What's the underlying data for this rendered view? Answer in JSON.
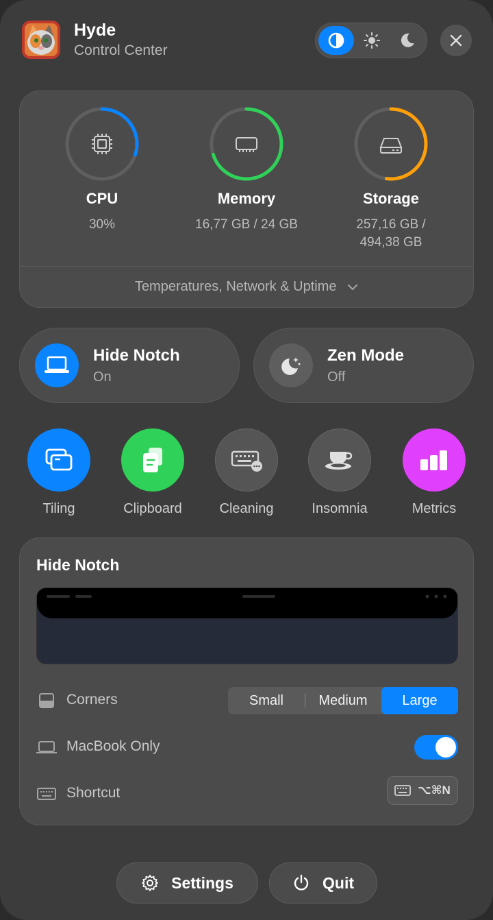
{
  "header": {
    "app_name": "Hyde",
    "subtitle": "Control Center",
    "theme_modes": [
      "auto",
      "light",
      "dark"
    ],
    "active_theme": "auto"
  },
  "stats": [
    {
      "label": "CPU",
      "value": "30%",
      "fraction": 0.3,
      "color": "#0a84ff",
      "icon": "cpu-icon"
    },
    {
      "label": "Memory",
      "value": "16,77 GB / 24 GB",
      "fraction": 0.7,
      "color": "#30d158",
      "icon": "memory-icon"
    },
    {
      "label": "Storage",
      "value_line1": "257,16 GB /",
      "value_line2": "494,38 GB",
      "fraction": 0.52,
      "color": "#ff9f0a",
      "icon": "drive-icon"
    }
  ],
  "stats_more": "Temperatures, Network & Uptime",
  "toggles": {
    "hide_notch": {
      "title": "Hide Notch",
      "state": "On",
      "color": "#0a84ff"
    },
    "zen_mode": {
      "title": "Zen Mode",
      "state": "Off",
      "color": "#5e5e5e"
    }
  },
  "quick_actions": [
    {
      "label": "Tiling",
      "color": "#0a84ff",
      "icon": "tiling-icon"
    },
    {
      "label": "Clipboard",
      "color": "#30d158",
      "icon": "clipboard-icon"
    },
    {
      "label": "Cleaning",
      "color": "#555555",
      "icon": "keyboard-clean-icon"
    },
    {
      "label": "Insomnia",
      "color": "#555555",
      "icon": "coffee-cup-icon"
    },
    {
      "label": "Metrics",
      "color": "#e040fb",
      "icon": "bar-chart-icon"
    }
  ],
  "notch_panel": {
    "title": "Hide Notch",
    "corners_label": "Corners",
    "corner_options": [
      "Small",
      "Medium",
      "Large"
    ],
    "corner_selected": "Large",
    "macbook_only_label": "MacBook Only",
    "macbook_only": true,
    "shortcut_label": "Shortcut",
    "shortcut_keys": "⌥⌘N"
  },
  "footer": {
    "settings_label": "Settings",
    "quit_label": "Quit"
  }
}
